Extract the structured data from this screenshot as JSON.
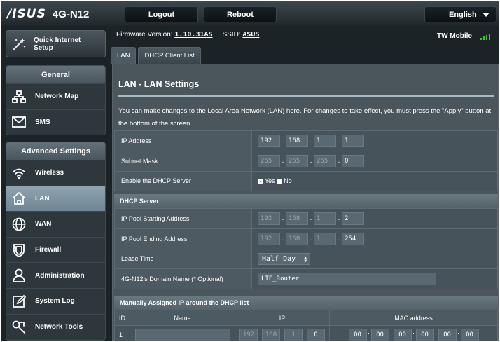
{
  "header": {
    "logo": "/ISUS",
    "model": "4G-N12",
    "logout": "Logout",
    "reboot": "Reboot",
    "language": "English"
  },
  "sidebar": {
    "qis_label_1": "Quick Internet",
    "qis_label_2": "Setup",
    "general_title": "General",
    "general_items": [
      {
        "label": "Network Map",
        "icon": "network-map-icon"
      },
      {
        "label": "SMS",
        "icon": "envelope-icon"
      }
    ],
    "advanced_title": "Advanced Settings",
    "advanced_items": [
      {
        "label": "Wireless",
        "icon": "wifi-icon"
      },
      {
        "label": "LAN",
        "icon": "home-icon"
      },
      {
        "label": "WAN",
        "icon": "globe-icon"
      },
      {
        "label": "Firewall",
        "icon": "shield-icon"
      },
      {
        "label": "Administration",
        "icon": "person-icon"
      },
      {
        "label": "System Log",
        "icon": "edit-icon"
      },
      {
        "label": "Network Tools",
        "icon": "tools-icon"
      }
    ]
  },
  "status": {
    "fw_label": "Firmware Version:",
    "fw_value": "1.10.31AS",
    "ssid_label": "SSID:",
    "ssid_value": "ASUS",
    "carrier": "TW Mobile",
    "signal_bars": 4
  },
  "tabs": [
    "LAN",
    "DHCP Client List"
  ],
  "panel": {
    "title": "LAN - LAN Settings",
    "description": "You can make changes to the Local Area Network (LAN) here. For changes to take effect, you must press the \"Apply\" button at the bottom of the screen."
  },
  "lan": {
    "ip_label": "IP Address",
    "ip": [
      "192",
      "168",
      "1",
      "1"
    ],
    "mask_label": "Subnet Mask",
    "mask": [
      "255",
      "255",
      "255",
      "0"
    ],
    "dhcp_label": "Enable the DHCP Server",
    "yes": "Yes",
    "no": "No"
  },
  "dhcp": {
    "section": "DHCP Server",
    "start_label": "IP Pool Starting Address",
    "start": [
      "192",
      "168",
      "1",
      "2"
    ],
    "end_label": "IP Pool Ending Address",
    "end": [
      "192",
      "168",
      "1",
      "254"
    ],
    "lease_label": "Lease Time",
    "lease_value": "Half Day",
    "domain_label": "4G-N12's Domain Name (* Optional)",
    "domain_value": "LTE_Router"
  },
  "manual": {
    "section": "Manually Assigned IP around the DHCP list",
    "headers": [
      "ID",
      "Name",
      "IP",
      "MAC address"
    ],
    "row_id": "1",
    "row_ip": [
      "192",
      "168",
      "1",
      "0"
    ],
    "row_mac": [
      "00",
      "00",
      "00",
      "00",
      "00",
      "00"
    ]
  }
}
